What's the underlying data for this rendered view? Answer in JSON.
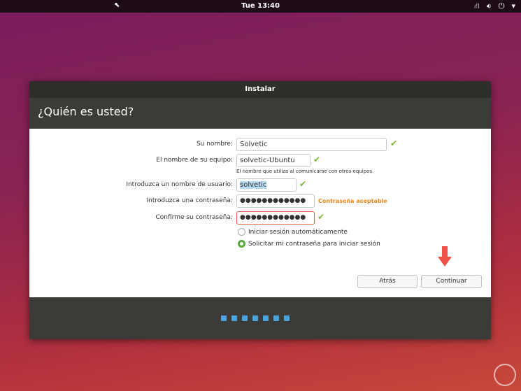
{
  "topbar": {
    "clock": "Tue 13:40",
    "icons": [
      "network-icon",
      "volume-icon",
      "power-icon",
      "menu-arrow-icon"
    ]
  },
  "window": {
    "title": "Instalar",
    "heading": "¿Quién es usted?"
  },
  "form": {
    "name_label": "Su nombre:",
    "name_value": "Solvetic",
    "computer_label": "El nombre de su equipo:",
    "computer_value": "solvetic-Ubuntu",
    "computer_hint": "El nombre que utiliza al comunicarse con otros equipos.",
    "user_label": "Introduzca un nombre de usuario:",
    "user_value": "solvetic",
    "password_label": "Introduzca una contraseña:",
    "password_value": "●●●●●●●●●●●●",
    "password_strength": "Contraseña aceptable",
    "confirm_label": "Confirme su contraseña:",
    "confirm_value": "●●●●●●●●●●●●",
    "radio_auto": "Iniciar sesión automáticamente",
    "radio_password": "Solicitar mi contraseña para iniciar sesión",
    "selected_radio": "radio_password"
  },
  "buttons": {
    "back": "Atrás",
    "continue": "Continuar"
  },
  "progress": {
    "total_steps": 7
  },
  "colors": {
    "accent": "#4aa3df",
    "check": "#7bb33c",
    "warning": "#f28a1e",
    "arrow": "#f0524a"
  }
}
